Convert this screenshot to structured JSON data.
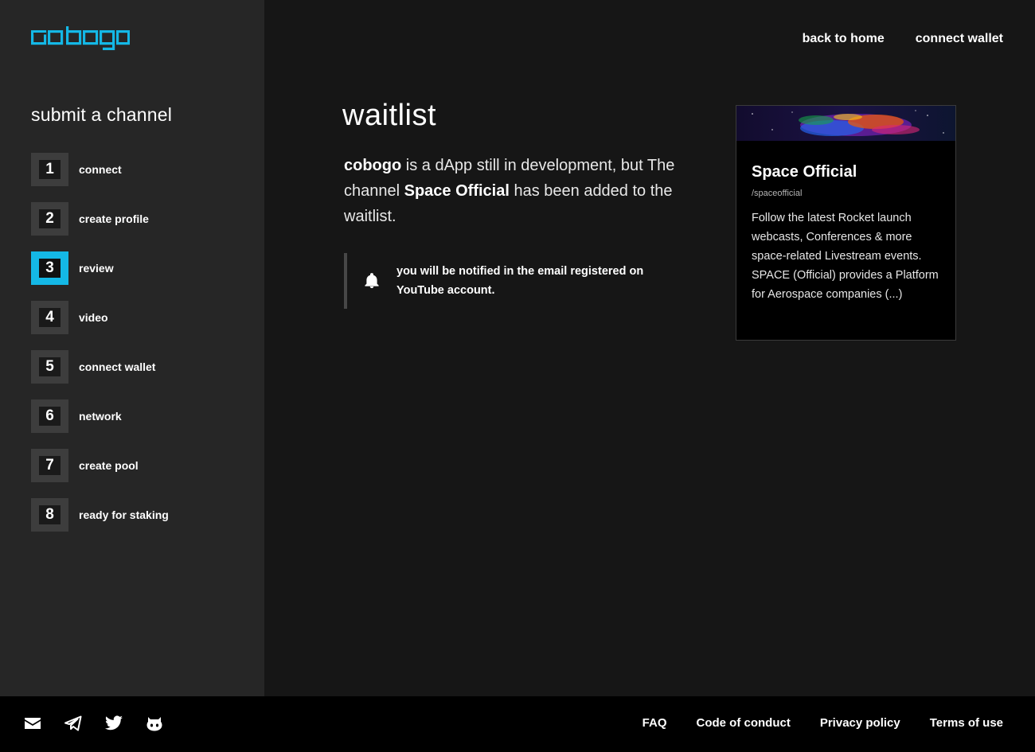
{
  "brand": {
    "logo_text": "cobogo",
    "accent_color": "#14b8e6"
  },
  "nav": {
    "back_home": "back to home",
    "connect_wallet": "connect wallet"
  },
  "sidebar": {
    "title": "submit a channel",
    "active_step": 3,
    "steps": [
      {
        "number": "1",
        "label": "connect"
      },
      {
        "number": "2",
        "label": "create profile"
      },
      {
        "number": "3",
        "label": "review"
      },
      {
        "number": "4",
        "label": "video"
      },
      {
        "number": "5",
        "label": "connect wallet"
      },
      {
        "number": "6",
        "label": "network"
      },
      {
        "number": "7",
        "label": "create pool"
      },
      {
        "number": "8",
        "label": "ready for staking"
      }
    ]
  },
  "main": {
    "title": "waitlist",
    "intro": {
      "brand": "cobogo",
      "part1": " is a dApp still in development, but The channel ",
      "channel": "Space Official",
      "part2": " has been added to the waitlist."
    },
    "notice": {
      "icon": "bell-icon",
      "text": "you will be notified in the email registered on YouTube account."
    }
  },
  "card": {
    "title": "Space Official",
    "handle": "/spaceofficial",
    "description": "Follow the latest Rocket launch webcasts, Conferences & more space-related Livestream events. SPACE (Official) provides a Platform for Aerospace companies (...)"
  },
  "footer": {
    "social_icons": [
      "mail-icon",
      "telegram-icon",
      "twitter-icon",
      "github-icon"
    ],
    "links": {
      "faq": "FAQ",
      "code": "Code of conduct",
      "privacy": "Privacy policy",
      "terms": "Terms of use"
    }
  }
}
